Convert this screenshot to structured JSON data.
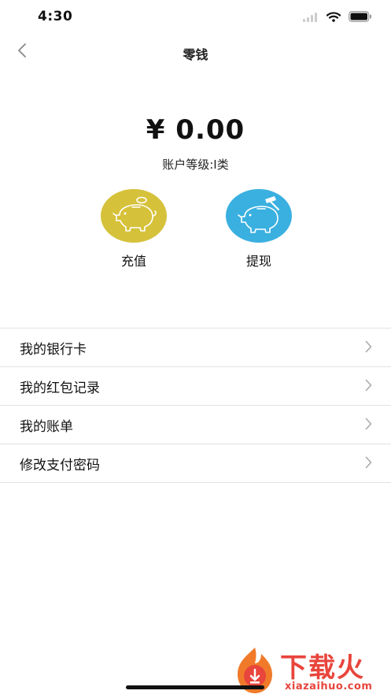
{
  "status_bar": {
    "time": "4:30"
  },
  "nav": {
    "title": "零钱"
  },
  "balance": {
    "amount": "¥ 0.00",
    "account_level": "账户等级:I类"
  },
  "actions": [
    {
      "label": "充值",
      "icon": "piggy-bank-coin-icon",
      "color": "#d6c13a"
    },
    {
      "label": "提现",
      "icon": "piggy-bank-hammer-icon",
      "color": "#3ab0e0"
    }
  ],
  "menu": [
    {
      "label": "我的银行卡"
    },
    {
      "label": "我的红包记录"
    },
    {
      "label": "我的账单"
    },
    {
      "label": "修改支付密码"
    }
  ],
  "watermark": {
    "text": "下载火",
    "sub": "xiazaihuo.com"
  }
}
